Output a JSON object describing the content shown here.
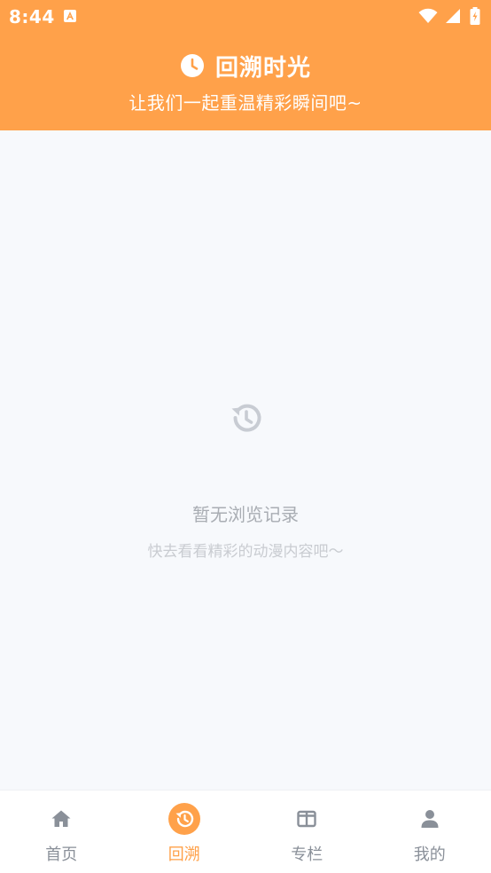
{
  "status_bar": {
    "time": "8:44"
  },
  "header": {
    "title": "回溯时光",
    "subtitle": "让我们一起重温精彩瞬间吧~"
  },
  "empty_state": {
    "title": "暂无浏览记录",
    "subtitle": "快去看看精彩的动漫内容吧～"
  },
  "bottom_nav": {
    "items": [
      {
        "label": "首页",
        "icon": "home-icon",
        "active": false
      },
      {
        "label": "回溯",
        "icon": "history-icon",
        "active": true
      },
      {
        "label": "专栏",
        "icon": "columns-icon",
        "active": false
      },
      {
        "label": "我的",
        "icon": "person-icon",
        "active": false
      }
    ]
  },
  "colors": {
    "accent": "#ffa14a",
    "inactive": "#8a9099",
    "background": "#f7f9fc"
  }
}
